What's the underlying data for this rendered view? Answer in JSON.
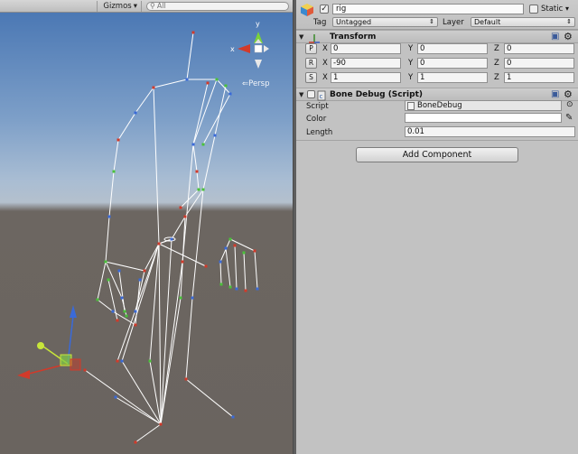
{
  "scene": {
    "gizmos_label": "Gizmos",
    "search_placeholder": "All",
    "view_mode": "Persp",
    "gizmo_axes": {
      "y": "y",
      "x": "x"
    }
  },
  "inspector": {
    "object_name": "rig",
    "static_label": "Static",
    "tag_label": "Tag",
    "tag_value": "Untagged",
    "layer_label": "Layer",
    "layer_value": "Default",
    "transform": {
      "title": "Transform",
      "position": {
        "button": "P",
        "x": "0",
        "y": "0",
        "z": "0"
      },
      "rotation": {
        "button": "R",
        "x": "-90",
        "y": "0",
        "z": "0"
      },
      "scale": {
        "button": "S",
        "x": "1",
        "y": "1",
        "z": "1"
      },
      "axis_labels": [
        "X",
        "Y",
        "Z"
      ]
    },
    "bone_debug": {
      "title": "Bone Debug (Script)",
      "script_label": "Script",
      "script_value": "BoneDebug",
      "color_label": "Color",
      "color_value": "#ffffff",
      "length_label": "Length",
      "length_value": "0.01"
    },
    "add_component_label": "Add Component"
  },
  "colors": {
    "sky_top": "#4b78b4",
    "ground": "#6a645f",
    "panel": "#c2c2c2",
    "x_axis": "#d23a2a",
    "y_axis": "#7bd23a",
    "z_axis": "#3a6ad8"
  }
}
